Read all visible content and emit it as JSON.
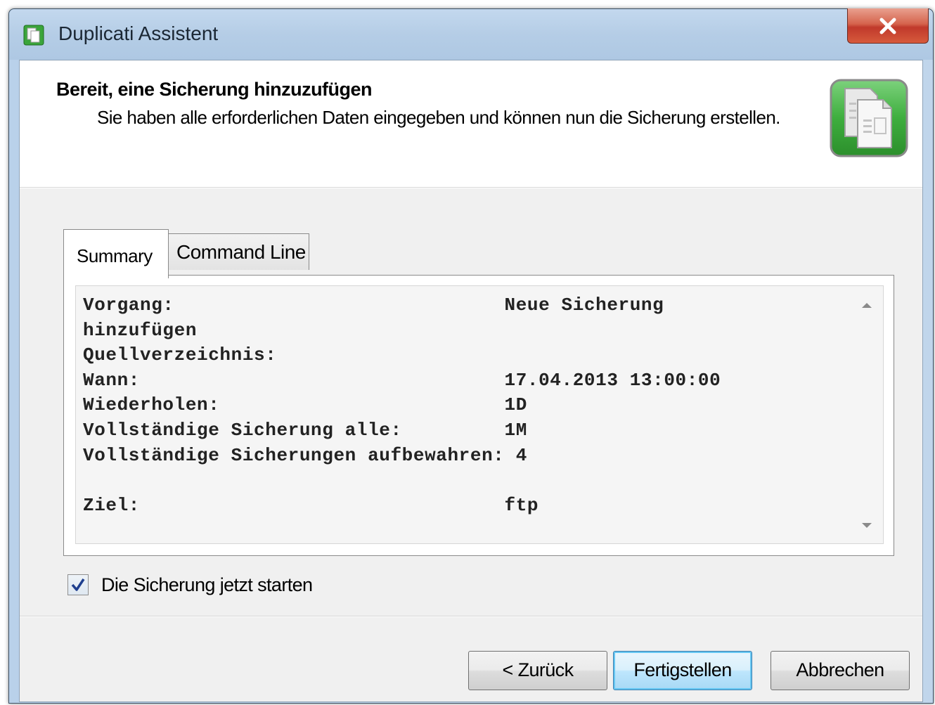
{
  "window": {
    "title": "Duplicati Assistent"
  },
  "header": {
    "title": "Bereit, eine Sicherung hinzuzufügen",
    "description": "Sie haben alle erforderlichen Daten eingegeben und können nun die Sicherung erstellen.",
    "icon": "documents-icon"
  },
  "tabs": [
    {
      "label": "Summary",
      "active": true
    },
    {
      "label": "Command Line",
      "active": false
    }
  ],
  "summary": {
    "lines": [
      "Vorgang:                             Neue Sicherung",
      "hinzufügen",
      "Quellverzeichnis:",
      "Wann:                                17.04.2013 13:00:00",
      "Wiederholen:                         1D",
      "Vollständige Sicherung alle:         1M",
      "Vollständige Sicherungen aufbewahren: 4",
      "",
      "Ziel:                                ftp"
    ]
  },
  "options": {
    "start_now_label": "Die Sicherung jetzt starten",
    "start_now_checked": true
  },
  "buttons": {
    "back": "< Zurück",
    "finish": "Fertigstellen",
    "cancel": "Abbrechen"
  },
  "colors": {
    "accent": "#3c7fb1",
    "close": "#c0392b",
    "icon_green": "#3aa53a"
  }
}
